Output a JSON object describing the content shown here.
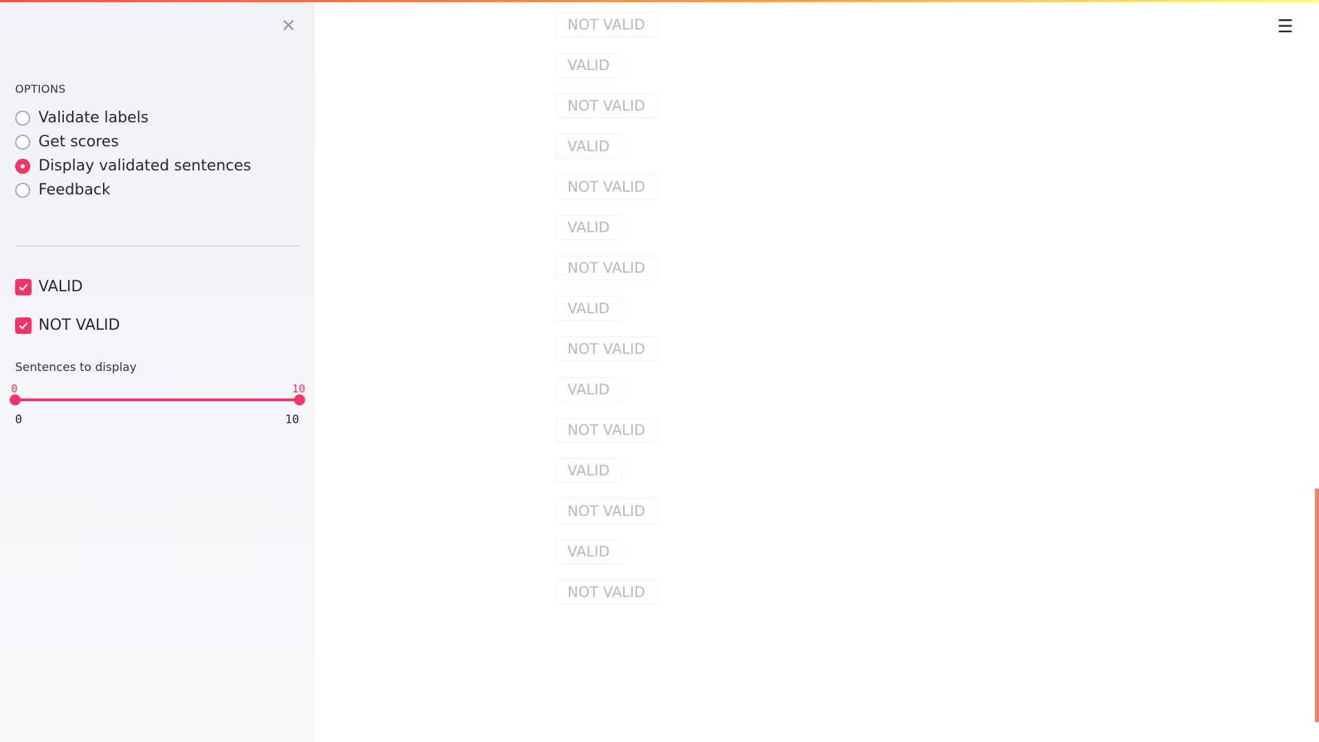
{
  "sidebar": {
    "close_icon": "close-icon",
    "section_label": "OPTIONS",
    "radio_options": [
      {
        "label": "Validate labels",
        "selected": false
      },
      {
        "label": "Get scores",
        "selected": false
      },
      {
        "label": "Display validated sentences",
        "selected": true
      },
      {
        "label": "Feedback",
        "selected": false
      }
    ],
    "checkboxes": [
      {
        "label": "VALID",
        "checked": true
      },
      {
        "label": "NOT VALID",
        "checked": true
      }
    ],
    "slider": {
      "label": "Sentences to display",
      "value_low": "0",
      "value_high": "10",
      "min_label": "0",
      "max_label": "10"
    }
  },
  "main": {
    "menu_icon": "hamburger-menu-icon",
    "sentences": [
      "NOT VALID",
      "VALID",
      "NOT VALID",
      "VALID",
      "NOT VALID",
      "VALID",
      "NOT VALID",
      "VALID",
      "NOT VALID",
      "VALID",
      "NOT VALID",
      "VALID",
      "NOT VALID",
      "VALID",
      "NOT VALID"
    ]
  },
  "colors": {
    "accent": "#f63366",
    "sidebar_bg": "#f0f2f6",
    "tag_text": "#b6b8be",
    "scrollbar": "#e2876c"
  }
}
